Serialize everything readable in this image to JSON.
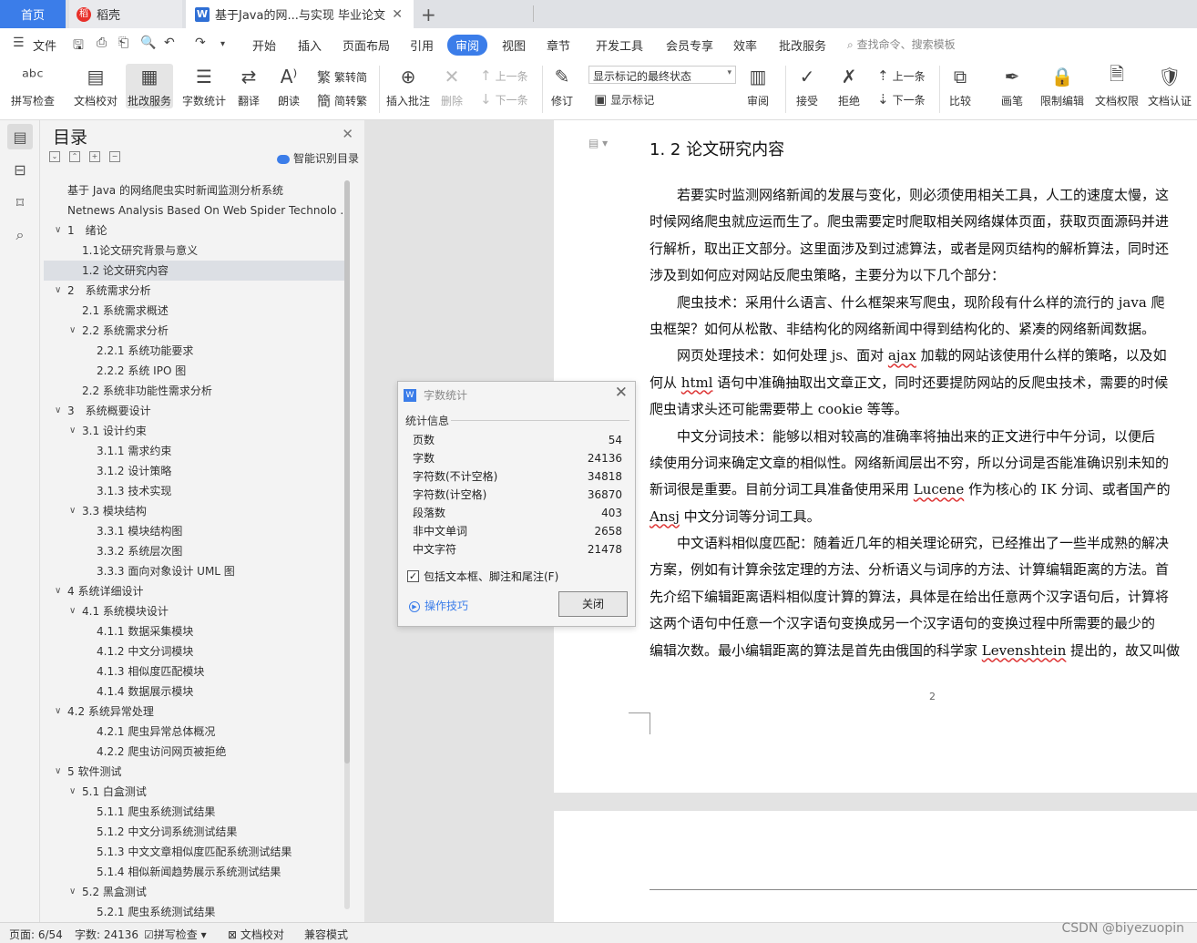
{
  "tabs": {
    "home": "首页",
    "daoke": "稻壳",
    "doc": "基于Java的网...与实现 毕业论文",
    "new": "+"
  },
  "menu": {
    "file": "文件",
    "items": [
      "开始",
      "插入",
      "页面布局",
      "引用",
      "审阅",
      "视图",
      "章节",
      "开发工具",
      "会员专享",
      "效率",
      "批改服务"
    ],
    "active": "审阅",
    "search": "查找命令、搜索模板"
  },
  "toolbar": {
    "spell": "拼写检查",
    "proof": "文档校对",
    "review_service": "批改服务",
    "word_count": "字数统计",
    "translate": "翻译",
    "read_aloud": "朗读",
    "trad": "繁转简",
    "simp": "简转繁",
    "insert_comment": "插入批注",
    "delete": "删除",
    "prev": "上一条",
    "next": "下一条",
    "revise": "修订",
    "mark_select": "显示标记的最终状态",
    "show_marks": "显示标记",
    "review": "审阅",
    "accept": "接受",
    "reject": "拒绝",
    "prev2": "上一条",
    "next2": "下一条",
    "compare": "比较",
    "pen": "画笔",
    "restrict": "限制编辑",
    "rights": "文档权限",
    "certify": "文档认证"
  },
  "toc": {
    "title": "目录",
    "smart": "智能识别目录",
    "items": [
      {
        "text": "基于 Java 的网络爬虫实时新闻监测分析系统",
        "level": 0,
        "toggle": ""
      },
      {
        "text": "Netnews Analysis Based On Web Spider Technolo ...",
        "level": 0,
        "toggle": ""
      },
      {
        "text": "1　绪论",
        "level": 0,
        "toggle": "v"
      },
      {
        "text": "1.1论文研究背景与意义",
        "level": 1,
        "toggle": ""
      },
      {
        "text": "1.2  论文研究内容",
        "level": 1,
        "toggle": "",
        "active": true
      },
      {
        "text": "2　系统需求分析",
        "level": 0,
        "toggle": "v"
      },
      {
        "text": "2.1  系统需求概述",
        "level": 1,
        "toggle": ""
      },
      {
        "text": "2.2  系统需求分析",
        "level": 1,
        "toggle": "v"
      },
      {
        "text": "2.2.1  系统功能要求",
        "level": 2,
        "toggle": ""
      },
      {
        "text": "2.2.2  系统 IPO 图",
        "level": 2,
        "toggle": ""
      },
      {
        "text": "2.2  系统非功能性需求分析",
        "level": 1,
        "toggle": ""
      },
      {
        "text": "3　系统概要设计",
        "level": 0,
        "toggle": "v"
      },
      {
        "text": "3.1  设计约束",
        "level": 1,
        "toggle": "v"
      },
      {
        "text": "3.1.1  需求约束",
        "level": 2,
        "toggle": ""
      },
      {
        "text": "3.1.2  设计策略",
        "level": 2,
        "toggle": ""
      },
      {
        "text": "3.1.3  技术实现",
        "level": 2,
        "toggle": ""
      },
      {
        "text": "3.3  模块结构",
        "level": 1,
        "toggle": "v"
      },
      {
        "text": "3.3.1  模块结构图",
        "level": 2,
        "toggle": ""
      },
      {
        "text": "3.3.2  系统层次图",
        "level": 2,
        "toggle": ""
      },
      {
        "text": "3.3.3  面向对象设计 UML 图",
        "level": 2,
        "toggle": ""
      },
      {
        "text": "4  系统详细设计",
        "level": 0,
        "toggle": "v"
      },
      {
        "text": "4.1  系统模块设计",
        "level": 1,
        "toggle": "v"
      },
      {
        "text": "4.1.1  数据采集模块",
        "level": 2,
        "toggle": ""
      },
      {
        "text": "4.1.2  中文分词模块",
        "level": 2,
        "toggle": ""
      },
      {
        "text": "4.1.3  相似度匹配模块",
        "level": 2,
        "toggle": ""
      },
      {
        "text": "4.1.4  数据展示模块",
        "level": 2,
        "toggle": ""
      },
      {
        "text": "4.2  系统异常处理",
        "level": 0,
        "toggle": "v"
      },
      {
        "text": "4.2.1  爬虫异常总体概况",
        "level": 2,
        "toggle": ""
      },
      {
        "text": "4.2.2  爬虫访问网页被拒绝",
        "level": 2,
        "toggle": ""
      },
      {
        "text": "5  软件测试",
        "level": 0,
        "toggle": "v"
      },
      {
        "text": "5.1  白盒测试",
        "level": 1,
        "toggle": "v"
      },
      {
        "text": "5.1.1  爬虫系统测试结果",
        "level": 2,
        "toggle": ""
      },
      {
        "text": "5.1.2  中文分词系统测试结果",
        "level": 2,
        "toggle": ""
      },
      {
        "text": "5.1.3  中文文章相似度匹配系统测试结果",
        "level": 2,
        "toggle": ""
      },
      {
        "text": "5.1.4  相似新闻趋势展示系统测试结果",
        "level": 2,
        "toggle": ""
      },
      {
        "text": "5.2  黑盒测试",
        "level": 1,
        "toggle": "v"
      },
      {
        "text": "5.2.1  爬虫系统测试结果",
        "level": 2,
        "toggle": ""
      }
    ]
  },
  "document": {
    "heading": "1. 2  论文研究内容",
    "lines": [
      "　　若要实时监测网络新闻的发展与变化，则必须使用相关工具，人工的速度太慢，这",
      "时候网络爬虫就应运而生了。爬虫需要定时爬取相关网络媒体页面，获取页面源码并进",
      "行解析，取出正文部分。这里面涉及到过滤算法，或者是网页结构的解析算法，同时还",
      "涉及到如何应对网站反爬虫策略，主要分为以下几个部分：",
      "　　爬虫技术：采用什么语言、什么框架来写爬虫，现阶段有什么样的流行的 java 爬",
      "虫框架？如何从松散、非结构化的网络新闻中得到结构化的、紧凑的网络新闻数据。",
      "　　网页处理技术：如何处理 js、面对 ajax 加载的网站该使用什么样的策略，以及如",
      "何从 html 语句中准确抽取出文章正文，同时还要提防网站的反爬虫技术，需要的时候",
      "爬虫请求头还可能需要带上 cookie 等等。",
      "　　中文分词技术：能够以相对较高的准确率将抽出来的正文进行中午分词，以便后",
      "续使用分词来确定文章的相似性。网络新闻层出不穷，所以分词是否能准确识别未知的",
      "新词很是重要。目前分词工具准备使用采用 Lucene 作为核心的 IK 分词、或者国产的",
      "Ansj 中文分词等分词工具。",
      "　　中文语料相似度匹配：随着近几年的相关理论研究，已经推出了一些半成熟的解决",
      "方案，例如有计算余弦定理的方法、分析语义与词序的方法、计算编辑距离的方法。首",
      "先介绍下编辑距离语料相似度计算的算法，具体是在给出任意两个汉字语句后，计算将",
      "这两个语句中任意一个汉字语句变换成另一个汉字语句的变换过程中所需要的最少的",
      "编辑次数。最小编辑距离的算法是首先由俄国的科学家 Levenshtein 提出的，故又叫做"
    ],
    "page_number": "2"
  },
  "dialog": {
    "title": "字数统计",
    "section": "统计信息",
    "stats": [
      {
        "label": "页数",
        "value": "54"
      },
      {
        "label": "字数",
        "value": "24136"
      },
      {
        "label": "字符数(不计空格)",
        "value": "34818"
      },
      {
        "label": "字符数(计空格)",
        "value": "36870"
      },
      {
        "label": "段落数",
        "value": "403"
      },
      {
        "label": "非中文单词",
        "value": "2658"
      },
      {
        "label": "中文字符",
        "value": "21478"
      }
    ],
    "checkbox": "包括文本框、脚注和尾注(F)",
    "tips": "操作技巧",
    "close": "关闭"
  },
  "status": {
    "page": "页面: 6/54",
    "words": "字数: 24136",
    "spell": "拼写检查",
    "proof": "文档校对",
    "compat": "兼容模式",
    "watermark": "CSDN @biyezuopin"
  }
}
